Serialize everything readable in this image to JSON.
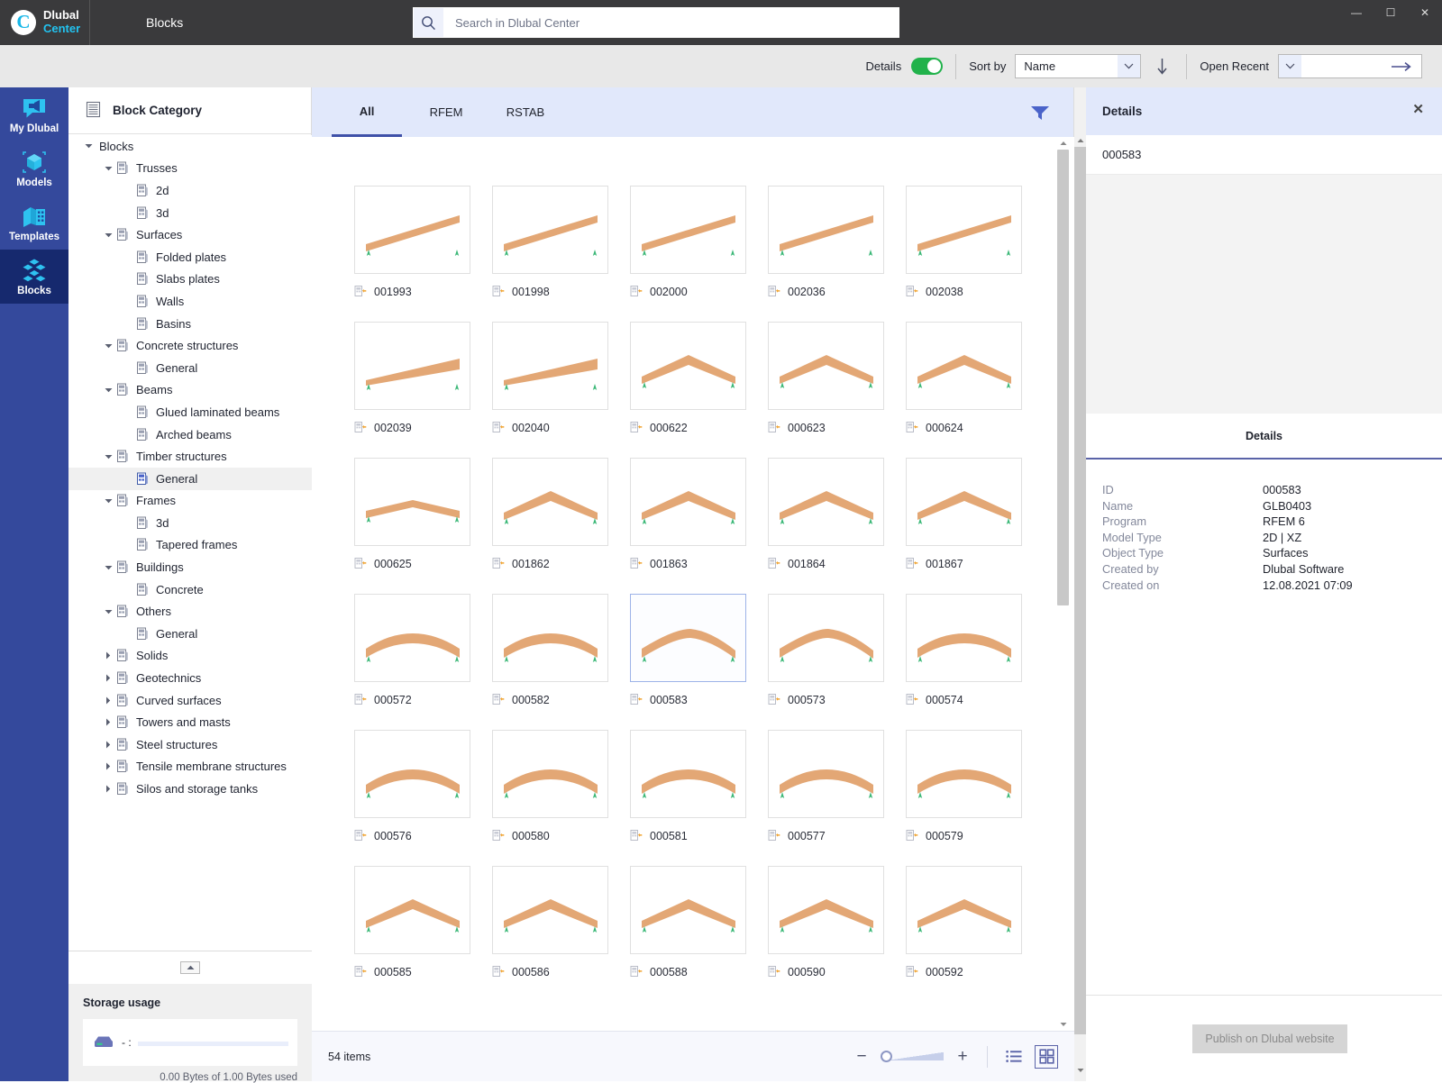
{
  "titlebar": {
    "brand_line1": "Dlubal",
    "brand_line2": "Center",
    "brand_mark": "C",
    "module": "Blocks",
    "search_placeholder": "Search in Dlubal Center",
    "search_value": "",
    "minimize": "—",
    "maximize": "☐",
    "close": "✕"
  },
  "toolbar": {
    "details_label": "Details",
    "details_on": true,
    "sort_by_label": "Sort by",
    "sort_by_value": "Name",
    "sort_direction": "descending",
    "open_recent_label": "Open Recent",
    "open_recent_value": ""
  },
  "rail": {
    "items": [
      {
        "label": "My Dlubal",
        "icon": "speech-bubble-icon",
        "active": false
      },
      {
        "label": "Models",
        "icon": "cube-icon",
        "active": false
      },
      {
        "label": "Templates",
        "icon": "templates-icon",
        "active": false
      },
      {
        "label": "Blocks",
        "icon": "blocks-icon",
        "active": true
      }
    ]
  },
  "tree": {
    "header": "Block Category",
    "nodes": [
      {
        "label": "Blocks",
        "depth": 0,
        "twisty": "down",
        "icon": false,
        "selected": false
      },
      {
        "label": "Trusses",
        "depth": 1,
        "twisty": "down",
        "icon": true,
        "selected": false
      },
      {
        "label": "2d",
        "depth": 2,
        "twisty": "none",
        "icon": true,
        "selected": false
      },
      {
        "label": "3d",
        "depth": 2,
        "twisty": "none",
        "icon": true,
        "selected": false
      },
      {
        "label": "Surfaces",
        "depth": 1,
        "twisty": "down",
        "icon": true,
        "selected": false
      },
      {
        "label": "Folded plates",
        "depth": 2,
        "twisty": "none",
        "icon": true,
        "selected": false
      },
      {
        "label": "Slabs plates",
        "depth": 2,
        "twisty": "none",
        "icon": true,
        "selected": false
      },
      {
        "label": "Walls",
        "depth": 2,
        "twisty": "none",
        "icon": true,
        "selected": false
      },
      {
        "label": "Basins",
        "depth": 2,
        "twisty": "none",
        "icon": true,
        "selected": false
      },
      {
        "label": "Concrete structures",
        "depth": 1,
        "twisty": "down",
        "icon": true,
        "selected": false
      },
      {
        "label": "General",
        "depth": 2,
        "twisty": "none",
        "icon": true,
        "selected": false
      },
      {
        "label": "Beams",
        "depth": 1,
        "twisty": "down",
        "icon": true,
        "selected": false
      },
      {
        "label": "Glued laminated beams",
        "depth": 2,
        "twisty": "none",
        "icon": true,
        "selected": false
      },
      {
        "label": "Arched beams",
        "depth": 2,
        "twisty": "none",
        "icon": true,
        "selected": false
      },
      {
        "label": "Timber structures",
        "depth": 1,
        "twisty": "down",
        "icon": true,
        "selected": false
      },
      {
        "label": "General",
        "depth": 2,
        "twisty": "none",
        "icon": true,
        "selected": true
      },
      {
        "label": "Frames",
        "depth": 1,
        "twisty": "down",
        "icon": true,
        "selected": false
      },
      {
        "label": "3d",
        "depth": 2,
        "twisty": "none",
        "icon": true,
        "selected": false
      },
      {
        "label": "Tapered frames",
        "depth": 2,
        "twisty": "none",
        "icon": true,
        "selected": false
      },
      {
        "label": "Buildings",
        "depth": 1,
        "twisty": "down",
        "icon": true,
        "selected": false
      },
      {
        "label": "Concrete",
        "depth": 2,
        "twisty": "none",
        "icon": true,
        "selected": false
      },
      {
        "label": "Others",
        "depth": 1,
        "twisty": "down",
        "icon": true,
        "selected": false
      },
      {
        "label": "General",
        "depth": 2,
        "twisty": "none",
        "icon": true,
        "selected": false
      },
      {
        "label": "Solids",
        "depth": 1,
        "twisty": "right",
        "icon": true,
        "selected": false
      },
      {
        "label": "Geotechnics",
        "depth": 1,
        "twisty": "right",
        "icon": true,
        "selected": false
      },
      {
        "label": "Curved surfaces",
        "depth": 1,
        "twisty": "right",
        "icon": true,
        "selected": false
      },
      {
        "label": "Towers and masts",
        "depth": 1,
        "twisty": "right",
        "icon": true,
        "selected": false
      },
      {
        "label": "Steel structures",
        "depth": 1,
        "twisty": "right",
        "icon": true,
        "selected": false
      },
      {
        "label": "Tensile membrane structures",
        "depth": 1,
        "twisty": "right",
        "icon": true,
        "selected": false
      },
      {
        "label": "Silos and storage tanks",
        "depth": 1,
        "twisty": "right",
        "icon": true,
        "selected": false
      }
    ]
  },
  "storage": {
    "title": "Storage usage",
    "drive_label": "- :",
    "used_text": "0.00 Bytes of 1.00 Bytes used",
    "percent": 0
  },
  "tabs": [
    {
      "label": "All",
      "active": true
    },
    {
      "label": "RFEM",
      "active": false
    },
    {
      "label": "RSTAB",
      "active": false
    }
  ],
  "grid": {
    "items": [
      {
        "id": "001993",
        "shape": "slope-up",
        "selected": false
      },
      {
        "id": "001998",
        "shape": "slope-up",
        "selected": false
      },
      {
        "id": "002000",
        "shape": "slope-up",
        "selected": false
      },
      {
        "id": "002036",
        "shape": "slope-up",
        "selected": false
      },
      {
        "id": "002038",
        "shape": "slope-up",
        "selected": false
      },
      {
        "id": "002039",
        "shape": "wedge",
        "selected": false
      },
      {
        "id": "002040",
        "shape": "wedge",
        "selected": false
      },
      {
        "id": "000622",
        "shape": "gable",
        "selected": false
      },
      {
        "id": "000623",
        "shape": "gable",
        "selected": false
      },
      {
        "id": "000624",
        "shape": "gable",
        "selected": false
      },
      {
        "id": "000625",
        "shape": "gable-low",
        "selected": false
      },
      {
        "id": "001862",
        "shape": "gable",
        "selected": false
      },
      {
        "id": "001863",
        "shape": "gable",
        "selected": false
      },
      {
        "id": "001864",
        "shape": "gable",
        "selected": false
      },
      {
        "id": "001867",
        "shape": "gable",
        "selected": false
      },
      {
        "id": "000572",
        "shape": "arch",
        "selected": false
      },
      {
        "id": "000582",
        "shape": "arch",
        "selected": false
      },
      {
        "id": "000583",
        "shape": "arch-peak",
        "selected": true
      },
      {
        "id": "000573",
        "shape": "arch-peak",
        "selected": false
      },
      {
        "id": "000574",
        "shape": "arch",
        "selected": false
      },
      {
        "id": "000576",
        "shape": "arch",
        "selected": false
      },
      {
        "id": "000580",
        "shape": "arch",
        "selected": false
      },
      {
        "id": "000581",
        "shape": "arch",
        "selected": false
      },
      {
        "id": "000577",
        "shape": "arch",
        "selected": false
      },
      {
        "id": "000579",
        "shape": "arch",
        "selected": false
      },
      {
        "id": "000585",
        "shape": "gable",
        "selected": false
      },
      {
        "id": "000586",
        "shape": "gable",
        "selected": false
      },
      {
        "id": "000588",
        "shape": "gable",
        "selected": false
      },
      {
        "id": "000590",
        "shape": "gable",
        "selected": false
      },
      {
        "id": "000592",
        "shape": "gable",
        "selected": false
      }
    ]
  },
  "statusbar": {
    "items_count": "54 items",
    "zoom_out": "−",
    "zoom_in": "+",
    "list_view": "list-view-icon",
    "grid_view": "grid-view-icon",
    "active_view": "grid"
  },
  "details_panel": {
    "header": "Details",
    "close": "✕",
    "id_bar": "000583",
    "tab": "Details",
    "properties": [
      {
        "key": "ID",
        "value": "000583"
      },
      {
        "key": "Name",
        "value": "GLB0403"
      },
      {
        "key": "Program",
        "value": "RFEM 6"
      },
      {
        "key": "Model Type",
        "value": "2D | XZ"
      },
      {
        "key": "Object Type",
        "value": "Surfaces"
      },
      {
        "key": "Created by",
        "value": "Dlubal Software"
      },
      {
        "key": "Created on",
        "value": "12.08.2021 07:09"
      }
    ],
    "publish_button": "Publish on Dlubal website"
  },
  "colors": {
    "rail_bg": "#34499c",
    "rail_active": "#16296e",
    "accent_blue": "#3f51a8",
    "tab_bg": "#e1e8fb",
    "toggle_on": "#21b24b",
    "timber": "#e3a775",
    "titlebar": "#3a3a3c"
  }
}
